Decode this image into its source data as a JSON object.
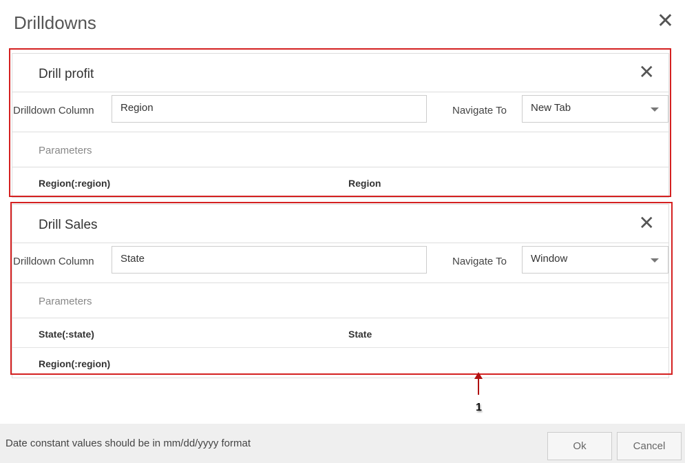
{
  "dialog": {
    "title": "Drilldowns",
    "ok_label": "Ok",
    "cancel_label": "Cancel",
    "footer_message": "Date constant values should be in mm/dd/yyyy format"
  },
  "labels": {
    "drilldown_column": "Drilldown Column",
    "navigate_to": "Navigate To",
    "parameters": "Parameters"
  },
  "drilldowns": [
    {
      "name": "Drill profit",
      "column": "Region",
      "navigate": "New Tab",
      "params": [
        {
          "param": "Region(:region)",
          "value": "Region"
        }
      ]
    },
    {
      "name": "Drill Sales",
      "column": "State",
      "navigate": "Window",
      "params": [
        {
          "param": "State(:state)",
          "value": "State"
        },
        {
          "param": "Region(:region)",
          "value": ""
        }
      ]
    }
  ],
  "annotation": {
    "marker": "1",
    "color": "#d42020"
  }
}
